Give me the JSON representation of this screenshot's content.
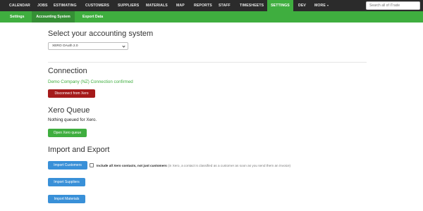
{
  "topnav": {
    "items": [
      "CALENDAR",
      "JOBS",
      "ESTIMATING",
      "CUSTOMERS",
      "SUPPLIERS",
      "MATERIALS",
      "MAP",
      "REPORTS",
      "STAFF",
      "TIMESHEETS",
      "SETTINGS",
      "DEV",
      "MORE"
    ],
    "active": "SETTINGS",
    "search_placeholder": "Search all of iTrade"
  },
  "subnav": {
    "items": [
      "Settings",
      "Accounting System",
      "Export Data"
    ],
    "active": "Accounting System"
  },
  "accounting": {
    "heading": "Select your accounting system",
    "selected": "XERO OAuth 2.0"
  },
  "connection": {
    "heading": "Connection",
    "status": "Demo Company (NZ) Connection confirmed",
    "disconnect_label": "Disconnect from Xero"
  },
  "queue": {
    "heading": "Xero Queue",
    "status": "Nothing queued for Xero.",
    "open_label": "Open Xero queue"
  },
  "import": {
    "heading": "Import and Export",
    "customers_label": "Import Customers",
    "checkbox_label": "Include all Xero contacts, not just customers",
    "checkbox_note": "(in Xero, a contact is classified as a customer as soon as you send them an invoice)",
    "suppliers_label": "Import Suppliers",
    "materials_label": "Import Materials"
  },
  "colors": {
    "topnav_bg": "#2b2b2b",
    "accent_green": "#3fae3f",
    "danger_red": "#a51a1a",
    "primary_blue": "#3990d8"
  }
}
